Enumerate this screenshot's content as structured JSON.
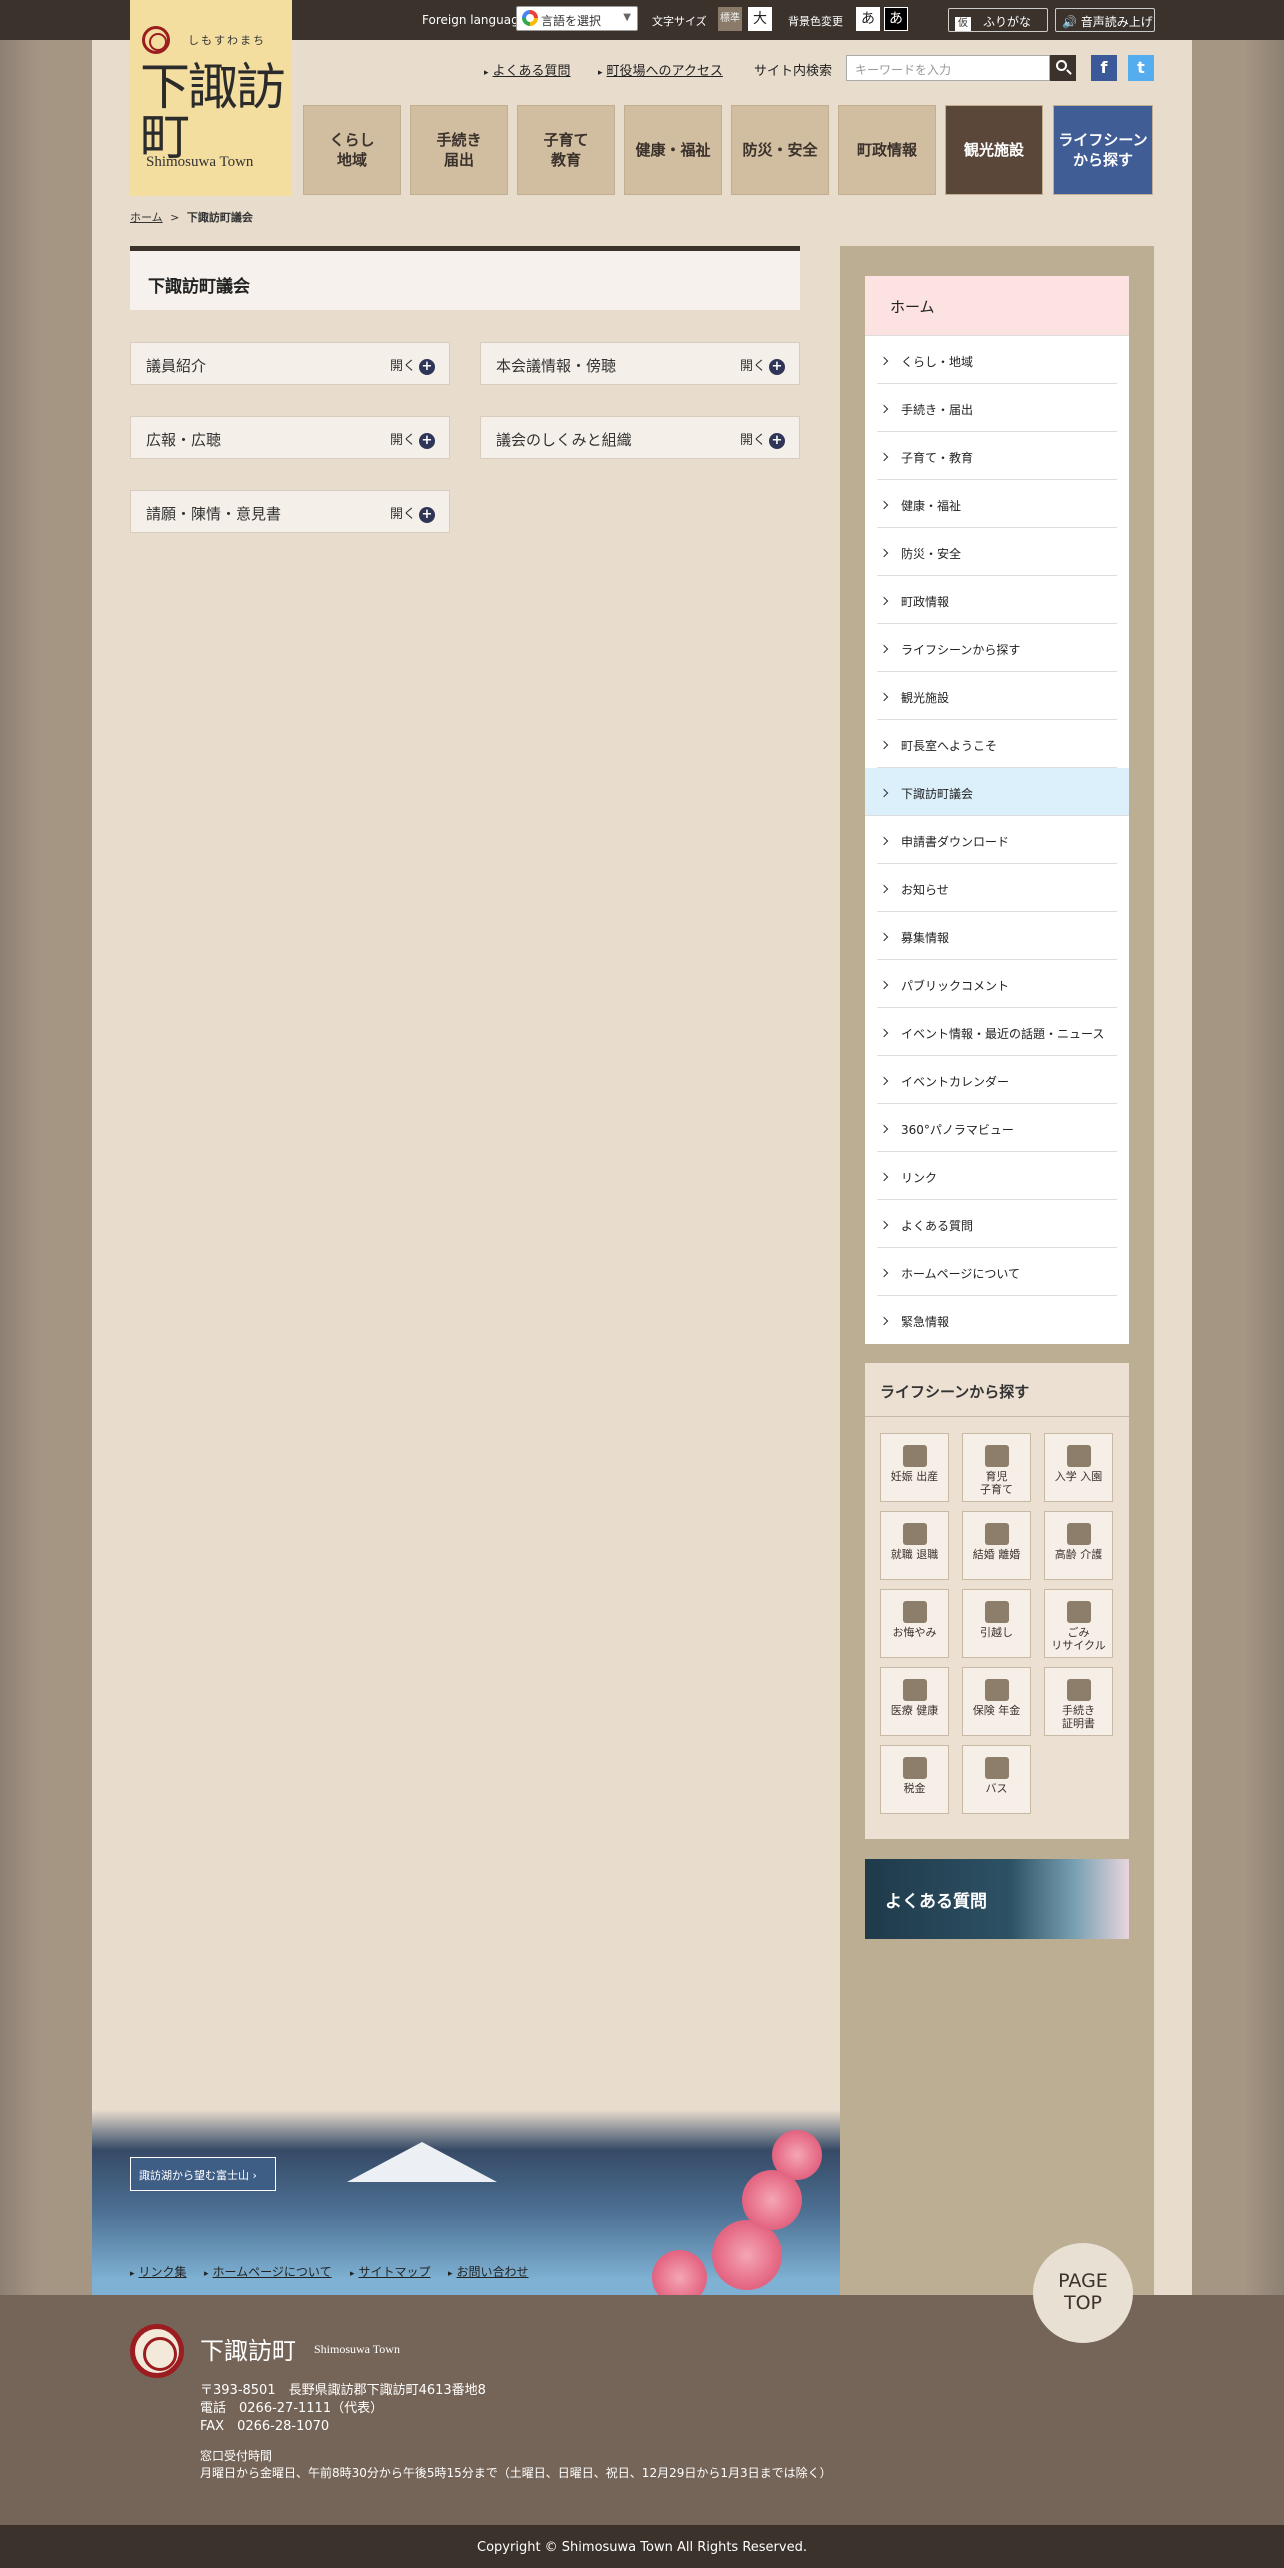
{
  "topbar": {
    "foreign_language": "Foreign language",
    "translate_select": "言語を選択",
    "text_size_label": "文字サイズ",
    "size_standard": "標準",
    "size_large": "大",
    "bg_color_label": "背景色変更",
    "bg_white": "あ",
    "bg_black": "あ",
    "furigana_icon": "仮",
    "furigana": "ふりがな",
    "voice": "音声読み上げ"
  },
  "logo": {
    "kana": "しもすわまち",
    "kanji": "下諏訪町",
    "en": "Shimosuwa Town"
  },
  "header_links": [
    "よくある質問",
    "町役場へのアクセス"
  ],
  "search": {
    "label": "サイト内検索",
    "placeholder": "キーワードを入力"
  },
  "sns": {
    "facebook": "f",
    "twitter": "t"
  },
  "nav": [
    "くらし\n地域",
    "手続き\n届出",
    "子育て\n教育",
    "健康・福祉",
    "防災・安全",
    "町政情報",
    "観光施設",
    "ライフシーン\nから探す"
  ],
  "breadcrumb": {
    "home": "ホーム",
    "separator": ">",
    "current": "下諏訪町議会"
  },
  "main": {
    "title": "下諏訪町議会",
    "open_label": "開く",
    "plus": "+",
    "accordions": [
      "議員紹介",
      "本会議情報・傍聴",
      "広報・広聴",
      "議会のしくみと組織",
      "請願・陳情・意見書"
    ]
  },
  "side_menu": {
    "head": "ホーム",
    "items": [
      "くらし・地域",
      "手続き・届出",
      "子育て・教育",
      "健康・福祉",
      "防災・安全",
      "町政情報",
      "ライフシーンから探す",
      "観光施設",
      "町長室へようこそ",
      "下諏訪町議会",
      "申請書ダウンロード",
      "お知らせ",
      "募集情報",
      "パブリックコメント",
      "イベント情報・最近の話題・ニュース",
      "イベントカレンダー",
      "360°パノラマビュー",
      "リンク",
      "よくある質問",
      "ホームページについて",
      "緊急情報"
    ],
    "active_index": 9
  },
  "life_scene": {
    "title": "ライフシーンから探す",
    "buttons": [
      "妊娠 出産",
      "育児\n子育て",
      "入学 入園",
      "就職 退職",
      "結婚 離婚",
      "高齢 介護",
      "お悔やみ",
      "引越し",
      "ごみ\nリサイクル",
      "医療 健康",
      "保険 年金",
      "手続き\n証明書",
      "税金",
      "バス"
    ]
  },
  "faq_banner": "よくある質問",
  "fuji_button": "諏訪湖から望む富士山 ›",
  "footer_links": [
    "リンク集",
    "ホームページについて",
    "サイトマップ",
    "お問い合わせ"
  ],
  "page_top": "PAGE\nTOP",
  "footer": {
    "name": "下諏訪町",
    "name_en": "Shimosuwa Town",
    "address": "〒393-8501　長野県諏訪郡下諏訪町4613番地8",
    "tel": "電話　0266-27-1111（代表）",
    "fax": "FAX　0266-28-1070",
    "hours_label": "窓口受付時間",
    "hours": "月曜日から金曜日、午前8時30分から午後5時15分まで（土曜日、日曜日、祝日、12月29日から1月3日までは除く）"
  },
  "copyright": "Copyright © Shimosuwa Town All Rights Reserved."
}
